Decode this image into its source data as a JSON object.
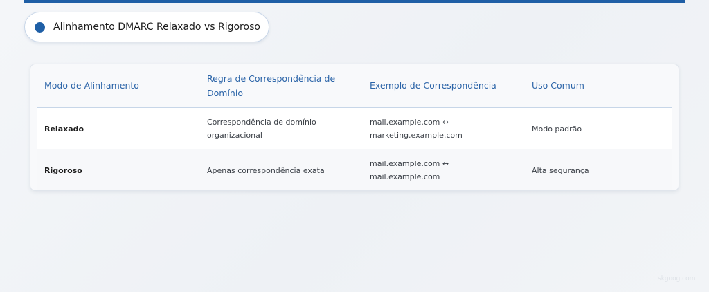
{
  "header": {
    "title": "Alinhamento DMARC Relaxado vs Rigoroso"
  },
  "table": {
    "columns": [
      "Modo de Alinhamento",
      "Regra de Correspondência de Domínio",
      "Exemplo de Correspondência",
      "Uso Comum"
    ],
    "rows": [
      {
        "mode": "Relaxado",
        "rule": "Correspondência de domínio organizacional",
        "example_line1": "mail.example.com ↔",
        "example_line2": "marketing.example.com",
        "usage": "Modo padrão"
      },
      {
        "mode": "Rigoroso",
        "rule": "Apenas correspondência exata",
        "example_line1": "mail.example.com ↔",
        "example_line2": "mail.example.com",
        "usage": "Alta segurança"
      }
    ]
  },
  "footer": {
    "watermark": "skgoog.com"
  },
  "colors": {
    "accent": "#1f5fa6",
    "header_text": "#2b64a8",
    "body_text": "#3a3f46"
  }
}
